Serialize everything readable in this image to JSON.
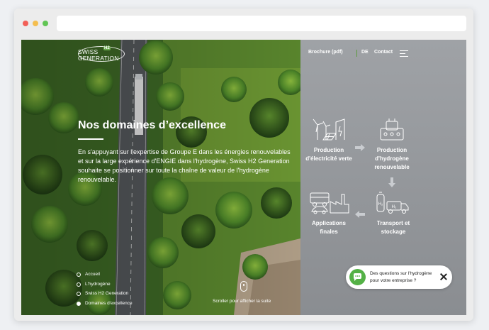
{
  "header": {
    "logo": "SWISS H2 GENERATION",
    "logo_line1": "SWISS",
    "logo_line2": "GENERATION",
    "logo_h2": "H2"
  },
  "nav": {
    "brochure": "Brochure (pdf)",
    "lang": "DE",
    "contact": "Contact"
  },
  "hero": {
    "title": "Nos domaines d’excellence",
    "body": "En s'appuyant sur l'expertise de Groupe E dans les énergies renouvelables et sur la large expérience d'ENGIE dans l'hydrogène, Swiss H2 Generation souhaite se positionner sur toute la chaîne de valeur de l'hydrogène renouvelable.",
    "scroll_hint": "Scroller pour afficher la suite"
  },
  "sidenav": {
    "items": [
      {
        "label": "Accueil",
        "active": false
      },
      {
        "label": "L'hydrogène",
        "active": false
      },
      {
        "label": "Swiss H2 Generation",
        "active": false
      },
      {
        "label": "Domaines d'excellence",
        "active": true
      }
    ]
  },
  "steps": {
    "production_electricity": "Production d'électricité verte",
    "production_hydrogen": "Production d'hydrogène renouvelable",
    "transport": "Transport et stockage",
    "applications": "Applications finales"
  },
  "step_badges": {
    "h2_a": "H₂",
    "h2_b": "H₂"
  },
  "chat": {
    "text": "Des questions sur l'hydrogène pour votre entreprise ?"
  },
  "colors": {
    "panel_grey": "#8f9296",
    "accent_green": "#54b146",
    "text_white": "#ffffff"
  }
}
